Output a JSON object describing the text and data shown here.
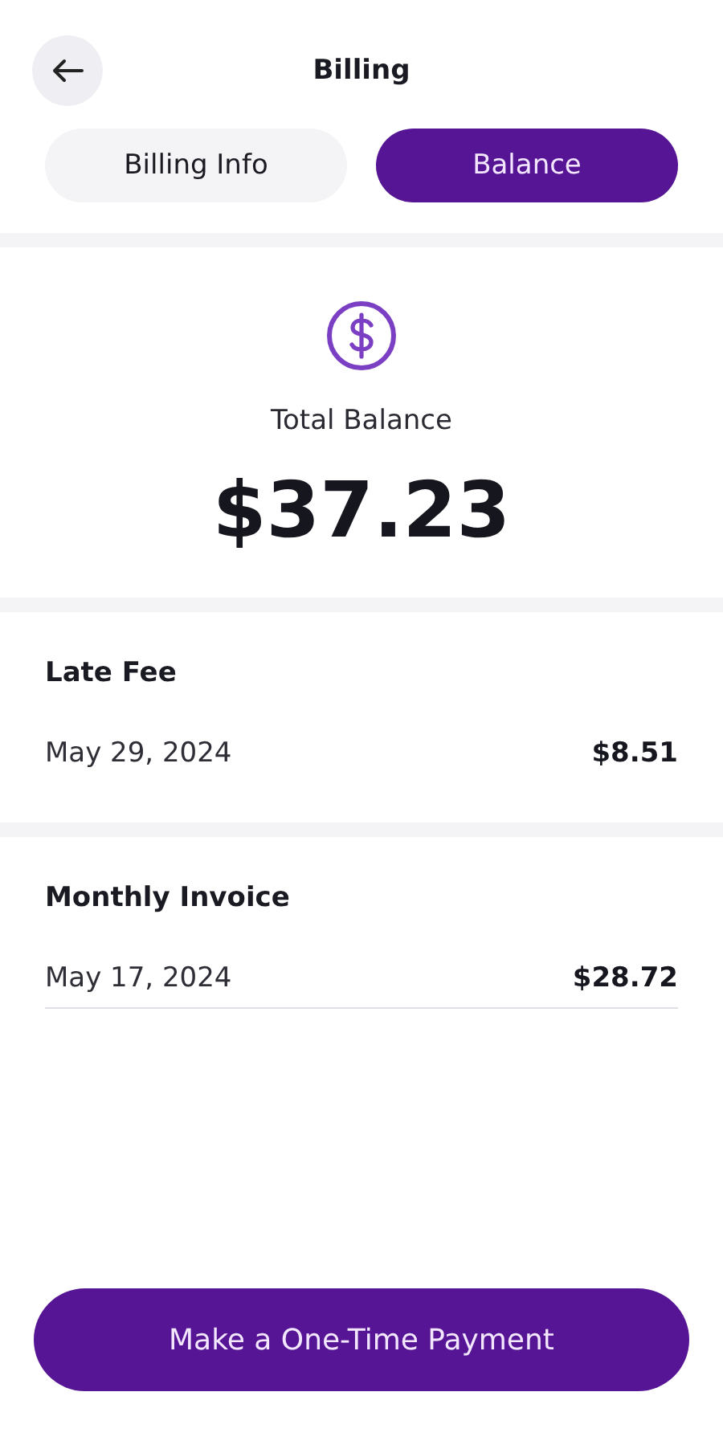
{
  "header": {
    "title": "Billing"
  },
  "tabs": [
    {
      "label": "Billing Info",
      "selected": false
    },
    {
      "label": "Balance",
      "selected": true
    }
  ],
  "balance": {
    "label": "Total Balance",
    "amount": "$37.23"
  },
  "charges": [
    {
      "title": "Late Fee",
      "date": "May 29, 2024",
      "amount": "$8.51",
      "underline": false
    },
    {
      "title": "Monthly Invoice",
      "date": "May 17, 2024",
      "amount": "$28.72",
      "underline": true
    }
  ],
  "action": {
    "label": "Make a One-Time Payment"
  }
}
